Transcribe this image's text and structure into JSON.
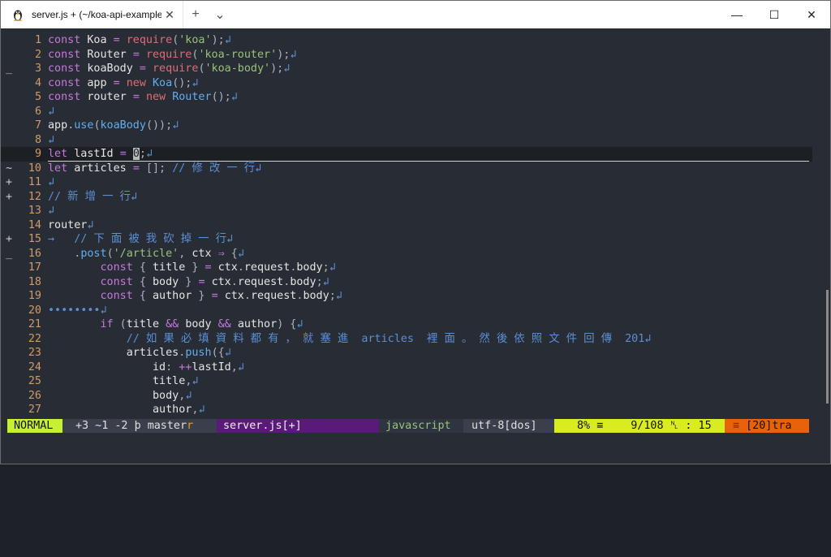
{
  "titlebar": {
    "tab_title": "server.js + (~/koa-api-example)",
    "tab_close": "✕",
    "new_tab": "+",
    "dropdown": "⌄",
    "minimize": "—",
    "maximize": "☐",
    "close": "✕"
  },
  "editor": {
    "lines": [
      {
        "n": "1",
        "sign": "",
        "html": "<span class='k'>const</span> <span class='id'>Koa</span> <span class='op'>=</span> <span class='red'>require</span>(<span class='str'>'koa'</span>);<span class='cr'>↲</span>"
      },
      {
        "n": "2",
        "sign": "",
        "html": "<span class='k'>const</span> <span class='id'>Router</span> <span class='op'>=</span> <span class='red'>require</span>(<span class='str'>'koa-router'</span>);<span class='cr'>↲</span>"
      },
      {
        "n": "3",
        "sign": "_",
        "html": "<span class='k'>const</span> <span class='id'>koaBody</span> <span class='op'>=</span> <span class='red'>require</span>(<span class='str'>'koa-body'</span>);<span class='cr'>↲</span>"
      },
      {
        "n": "4",
        "sign": "",
        "html": "<span class='k'>const</span> <span class='id'>app</span> <span class='op'>=</span> <span class='red'>new</span> <span class='fn'>Koa</span>();<span class='cr'>↲</span>"
      },
      {
        "n": "5",
        "sign": "",
        "html": "<span class='k'>const</span> <span class='id'>router</span> <span class='op'>=</span> <span class='red'>new</span> <span class='fn'>Router</span>();<span class='cr'>↲</span>"
      },
      {
        "n": "6",
        "sign": "",
        "html": "<span class='cr'>↲</span>"
      },
      {
        "n": "7",
        "sign": "",
        "html": "<span class='id'>app</span>.<span class='fn'>use</span>(<span class='fn'>koaBody</span>());<span class='cr'>↲</span>"
      },
      {
        "n": "8",
        "sign": "",
        "html": "<span class='cr'>↲</span>"
      },
      {
        "n": "9",
        "sign": "",
        "cur": true,
        "html": "<span class='k'>let</span> <span class='id'>lastId</span> <span class='op'>=</span> <span class='cursor'>0</span>;<span class='cr'>↲</span>"
      },
      {
        "n": "10",
        "sign": "~",
        "html": "<span class='k'>let</span> <span class='id'>articles</span> <span class='op'>=</span> []; <span class='cmt'>// 修 改 一 行</span><span class='cr'>↲</span>"
      },
      {
        "n": "11",
        "sign": "+",
        "html": "<span class='cr'>↲</span>"
      },
      {
        "n": "12",
        "sign": "+",
        "html": "<span class='cmt'>// 新 增 一 行</span><span class='cr'>↲</span>"
      },
      {
        "n": "13",
        "sign": "",
        "html": "<span class='cr'>↲</span>"
      },
      {
        "n": "14",
        "sign": "",
        "html": "<span class='id'>router</span><span class='cr'>↲</span>"
      },
      {
        "n": "15",
        "sign": "+",
        "html": "<span class='tab-arrow'>→</span>   <span class='cmt'>// 下 面 被 我 砍 掉 一 行</span><span class='cr'>↲</span>"
      },
      {
        "n": "16",
        "sign": "_",
        "html": "    .<span class='fn'>post</span>(<span class='str'>'/article'</span>, <span class='id'>ctx</span> <span class='op'>⇒</span> {<span class='cr'>↲</span>"
      },
      {
        "n": "17",
        "sign": "",
        "html": "        <span class='k'>const</span> { <span class='id'>title</span> } <span class='op'>=</span> <span class='id'>ctx</span>.<span class='id'>request</span>.<span class='id'>body</span>;<span class='cr'>↲</span>"
      },
      {
        "n": "18",
        "sign": "",
        "html": "        <span class='k'>const</span> { <span class='id'>body</span> } <span class='op'>=</span> <span class='id'>ctx</span>.<span class='id'>request</span>.<span class='id'>body</span>;<span class='cr'>↲</span>"
      },
      {
        "n": "19",
        "sign": "",
        "html": "        <span class='k'>const</span> { <span class='id'>author</span> } <span class='op'>=</span> <span class='id'>ctx</span>.<span class='id'>request</span>.<span class='id'>body</span>;<span class='cr'>↲</span>"
      },
      {
        "n": "20",
        "sign": "",
        "html": "<span class='cr'>••••••••↲</span>"
      },
      {
        "n": "21",
        "sign": "",
        "html": "        <span class='k'>if</span> (<span class='id'>title</span> <span class='op'>&amp;&amp;</span> <span class='id'>body</span> <span class='op'>&amp;&amp;</span> <span class='id'>author</span>) {<span class='cr'>↲</span>"
      },
      {
        "n": "22",
        "sign": "",
        "html": "            <span class='cmt'>// 如 果 必 填 資 料 都 有 ， 就 塞 進  articles  裡 面 。 然 後 依 照 文 件 回 傳  201</span><span class='cr'>↲</span>"
      },
      {
        "n": "23",
        "sign": "",
        "html": "            <span class='id'>articles</span>.<span class='fn'>push</span>({<span class='cr'>↲</span>"
      },
      {
        "n": "24",
        "sign": "",
        "html": "                <span class='id'>id</span>: <span class='op'>++</span><span class='id'>lastId</span>,<span class='cr'>↲</span>"
      },
      {
        "n": "25",
        "sign": "",
        "html": "                <span class='id'>title</span>,<span class='cr'>↲</span>"
      },
      {
        "n": "26",
        "sign": "",
        "html": "                <span class='id'>body</span>,<span class='cr'>↲</span>"
      },
      {
        "n": "27",
        "sign": "",
        "html": "                <span class='id'>author</span>,<span class='cr'>↲</span>"
      }
    ]
  },
  "statusline": {
    "mode": "NORMAL",
    "diff": "+3 ~1 -2",
    "branch_icon": "ϸ",
    "branch": "master",
    "branch_cut": "r",
    "filename": "server.js[+]",
    "filetype": "javascript",
    "encoding": "utf-8[dos]",
    "percent": "8%",
    "percent_icon": "≡",
    "position": "9/108",
    "ln_icon": "␤",
    "column": ": 15",
    "warn_icon": "≡",
    "warnings": "[20]tra",
    "colors": {
      "mode_bg": "#c5f033",
      "diff_bg": "#3a3f4b",
      "file_bg": "#5a1a7a",
      "type_bg": "#2e3440",
      "enc_bg": "#3a3f4b",
      "pos_bg": "#d8ec1f",
      "warn_bg": "#e8620c"
    }
  }
}
